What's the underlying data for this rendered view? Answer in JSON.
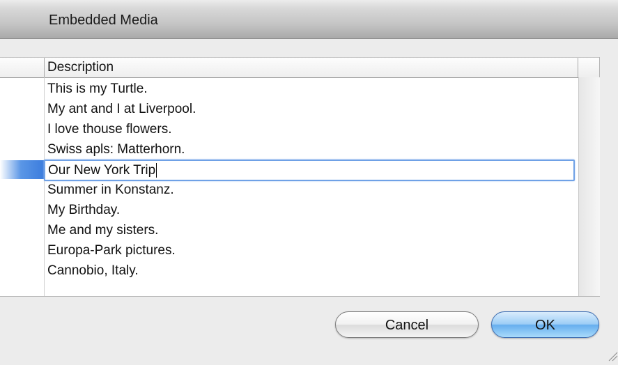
{
  "window": {
    "title": "Embedded Media"
  },
  "table": {
    "column_header": "Description",
    "rows": [
      "This is my Turtle.",
      "My ant and I at Liverpool.",
      "I love thouse flowers.",
      "Swiss apls: Matterhorn.",
      "Our New York Trip",
      "Summer in Konstanz.",
      "My Birthday.",
      "Me and my sisters.",
      "Europa-Park pictures.",
      "Cannobio, Italy."
    ],
    "editing_row_index": 4
  },
  "buttons": {
    "cancel": "Cancel",
    "ok": "OK"
  },
  "colors": {
    "selection": "#3b7cdd",
    "default_button": "#66aeee",
    "edit_focus_ring": "#6fa1e6"
  }
}
